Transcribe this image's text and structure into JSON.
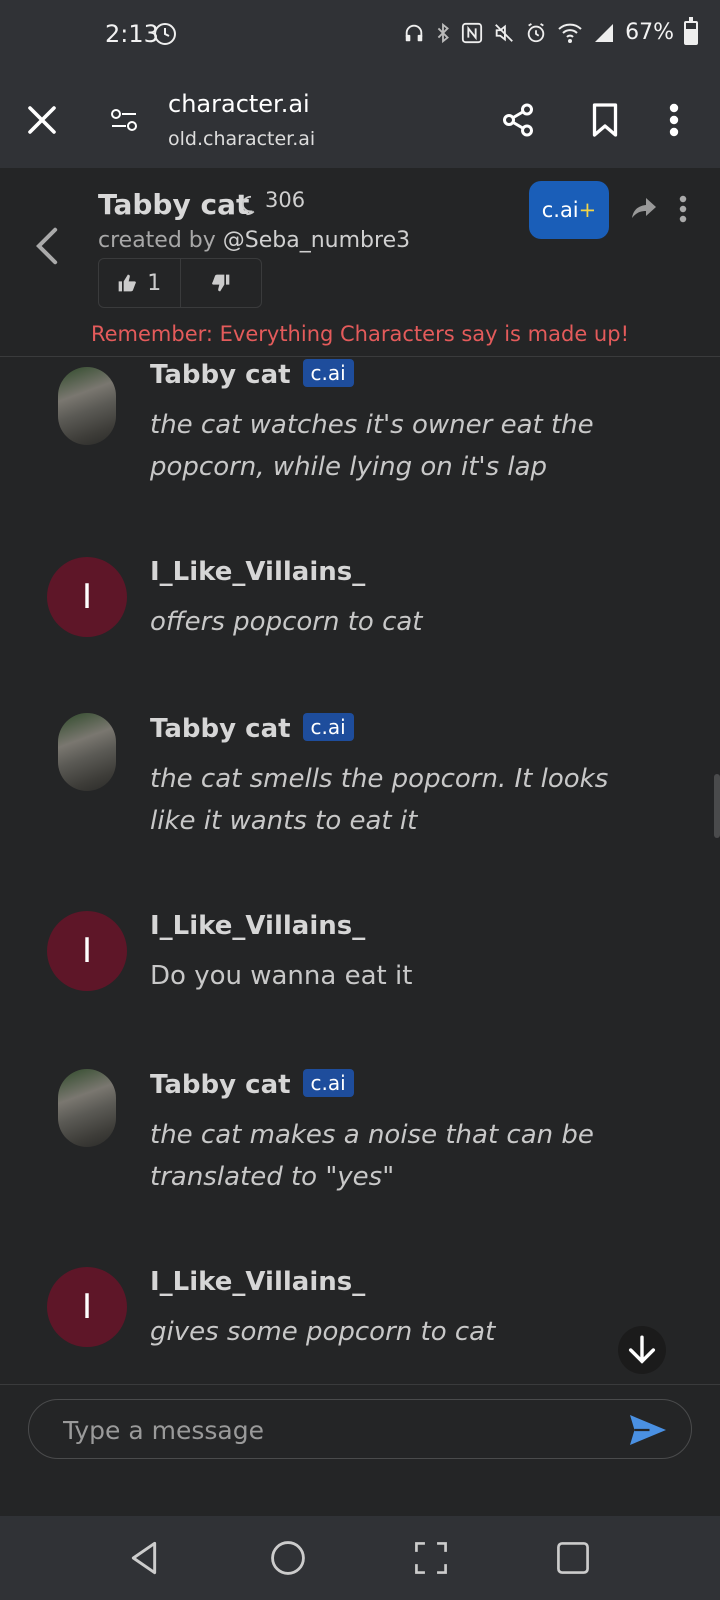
{
  "status_bar": {
    "time": "2:13",
    "battery_percent": "67%",
    "battery_level": 0.67
  },
  "browser": {
    "title": "character.ai",
    "url": "old.character.ai"
  },
  "character": {
    "name": "Tabby cat",
    "chat_count": "306",
    "created_by_prefix": "created by ",
    "created_by_handle": "@Seba_numbre3",
    "likes": "1",
    "cai_plus_label": "c.ai",
    "cai_plus_mark": "+",
    "disclaimer": "Remember: Everything Characters say is made up!"
  },
  "messages": [
    {
      "sender": "Tabby cat",
      "type": "character",
      "badge": "c.ai",
      "text": "the cat watches it's owner eat the popcorn, while lying on it's lap",
      "italic": true
    },
    {
      "sender": "I_Like_Villains_",
      "type": "user",
      "avatar_letter": "I",
      "text": "offers popcorn to cat",
      "italic": true
    },
    {
      "sender": "Tabby cat",
      "type": "character",
      "badge": "c.ai",
      "text": "the cat smells the popcorn. It looks like it wants to eat it",
      "italic": true
    },
    {
      "sender": "I_Like_Villains_",
      "type": "user",
      "avatar_letter": "I",
      "text": "Do you wanna eat it",
      "italic": false
    },
    {
      "sender": "Tabby cat",
      "type": "character",
      "badge": "c.ai",
      "text": "the cat makes a noise that can be translated to \"yes\"",
      "italic": true
    },
    {
      "sender": "I_Like_Villains_",
      "type": "user",
      "avatar_letter": "I",
      "text": "gives some popcorn to cat",
      "italic": true
    }
  ],
  "composer": {
    "placeholder": "Type a message"
  },
  "colors": {
    "background": "#242526",
    "bar": "#303236",
    "user_avatar": "#5e1628",
    "badge": "#1e4d9c",
    "cai_plus": "#1a5eb8",
    "disclaimer": "#e45b5b",
    "send": "#4a90e2"
  }
}
